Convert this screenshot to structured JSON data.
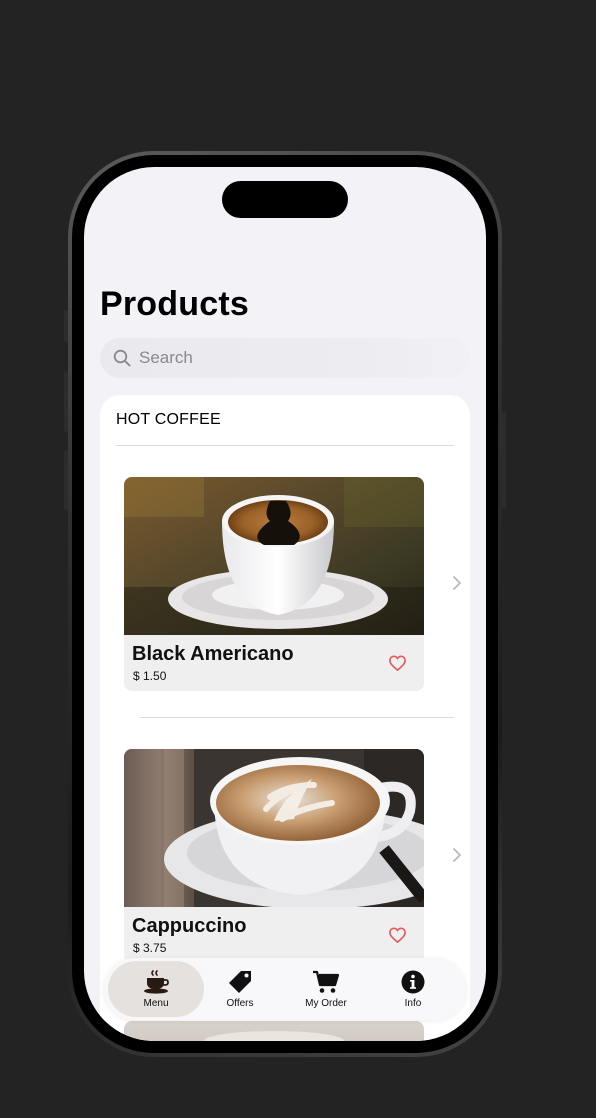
{
  "screen": {
    "title": "Products",
    "search": {
      "placeholder": "Search"
    }
  },
  "section": {
    "header": "HOT COFFEE",
    "products": [
      {
        "name": "Black Americano",
        "price": "$ 1.50",
        "favorite_icon": "heart-outline-icon",
        "chevron_icon": "chevron-right-icon"
      },
      {
        "name": "Cappuccino",
        "price": "$ 3.75",
        "favorite_icon": "heart-outline-icon",
        "chevron_icon": "chevron-right-icon"
      }
    ]
  },
  "tab_bar": {
    "items": [
      {
        "label": "Menu",
        "icon": "coffee-cup-icon",
        "active": true
      },
      {
        "label": "Offers",
        "icon": "tag-icon",
        "active": false
      },
      {
        "label": "My Order",
        "icon": "cart-icon",
        "active": false
      },
      {
        "label": "Info",
        "icon": "info-icon",
        "active": false
      }
    ]
  },
  "colors": {
    "background": "#232323",
    "screen_background": "#f2f2f7",
    "card_background": "#ffffff",
    "product_caption_background": "#efefef",
    "heart": "#e05a5a",
    "active_tab_pill": "#e4e1de"
  }
}
